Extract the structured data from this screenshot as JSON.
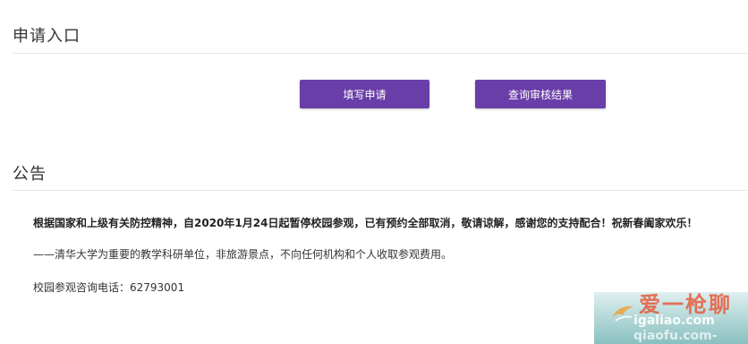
{
  "apply_section": {
    "title": "申请入口",
    "buttons": {
      "apply_label": "填写申请",
      "check_label": "查询审核结果"
    }
  },
  "notice_section": {
    "title": "公告",
    "lines": [
      "根据国家和上级有关防控精神，自2020年1月24日起暂停校园参观，已有预约全部取消，敬请谅解，感谢您的支持配合！祝新春阖家欢乐！",
      "——清华大学为重要的教学科研单位，非旅游景点，不向任何机构和个人收取参观费用。",
      "校园参观咨询电话：62793001"
    ]
  },
  "watermark": {
    "brand": "爱一枪聊",
    "domain": "igaliao.com",
    "sub": "qiaofu.com-"
  },
  "colors": {
    "button_bg": "#6a3ea9",
    "text": "#333333",
    "divider": "#e6e6e6"
  }
}
